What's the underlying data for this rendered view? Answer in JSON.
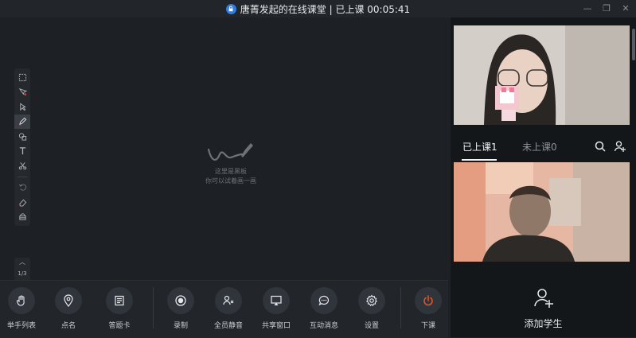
{
  "window": {
    "title": "唐菁发起的在线课堂 | 已上课 00:05:41"
  },
  "board": {
    "hint_line1": "这里是黑板",
    "hint_line2": "你可以试着画一画",
    "page_indicator": "1/3",
    "tools": [
      "select-area-icon",
      "laser-pointer-icon",
      "pointer-icon",
      "pen-icon",
      "shape-icon",
      "text-icon",
      "scissors-icon",
      "undo-icon",
      "eraser-icon",
      "clear-board-icon"
    ]
  },
  "toolbar": {
    "raise_hand": "举手列表",
    "roll_call": "点名",
    "answer_card": "答题卡",
    "record": "录制",
    "mute_all": "全员静音",
    "share_window": "共享窗口",
    "messages": "互动消息",
    "settings": "设置",
    "end_class": "下课",
    "end_class_color": "#e2582b"
  },
  "side": {
    "tab_in_class": "已上课1",
    "tab_not_in_class": "未上课0",
    "add_student": "添加学生"
  }
}
